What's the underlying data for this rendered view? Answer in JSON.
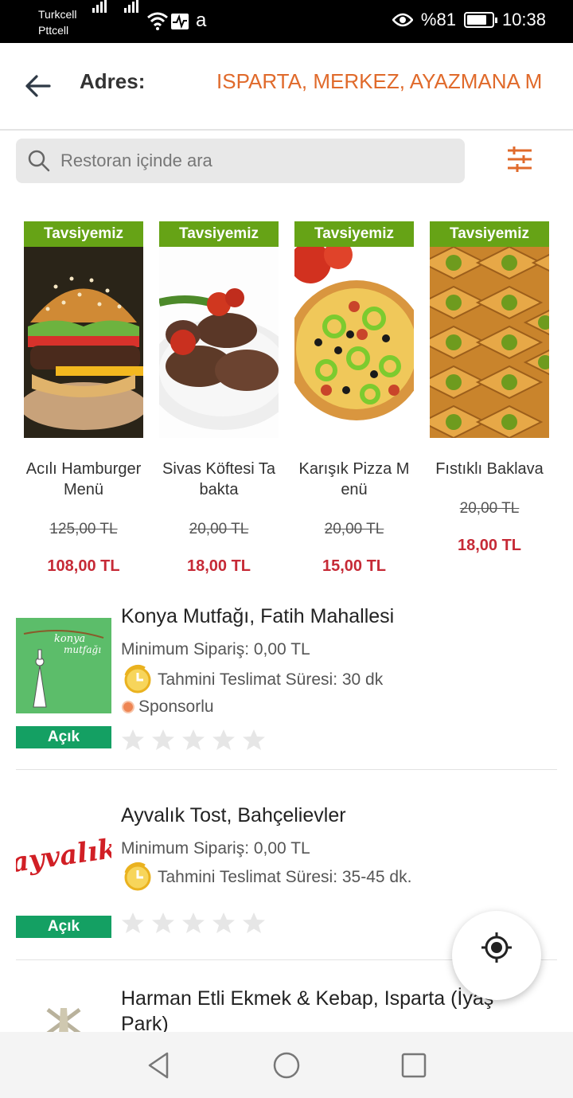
{
  "status_bar": {
    "carrier1": "Turkcell",
    "carrier2": "Pttcell",
    "extra": "a",
    "battery": "%81",
    "battery_level": 0.81,
    "time": "10:38"
  },
  "header": {
    "address_label": "Adres:",
    "address_value": "ISPARTA, MERKEZ, AYAZMANA M"
  },
  "search": {
    "placeholder": "Restoran içinde ara"
  },
  "recommendations": [
    {
      "badge": "Tavsiyemiz",
      "name": "Acılı Hamburger Menü",
      "old_price": "125,00 TL",
      "price": "108,00 TL"
    },
    {
      "badge": "Tavsiyemiz",
      "name": "Sivas Köftesi Tabakta",
      "old_price": "20,00 TL",
      "price": "18,00 TL"
    },
    {
      "badge": "Tavsiyemiz",
      "name": "Karışık Pizza Menü",
      "old_price": "20,00 TL",
      "price": "15,00 TL"
    },
    {
      "badge": "Tavsiyemiz",
      "name": "Fıstıklı Baklava",
      "old_price": "20,00 TL",
      "price": "18,00 TL"
    }
  ],
  "restaurants": [
    {
      "name": "Konya Mutfağı, Fatih Mahallesi",
      "min_order": "Minimum Sipariş: 0,00 TL",
      "eta": "Tahmini Teslimat Süresi: 30 dk",
      "sponsored": "Sponsorlu",
      "status": "Açık",
      "rating": 0,
      "logo_text": "konya mutfağı"
    },
    {
      "name": "Ayvalık Tost, Bahçelievler",
      "min_order": "Minimum Sipariş: 0,00 TL",
      "eta": "Tahmini Teslimat Süresi: 35-45 dk.",
      "status": "Açık",
      "rating": 0,
      "logo_text": "ayvalık"
    },
    {
      "name_line1": "Harman Etli Ekmek & Kebap, Isparta (İyaş",
      "name_line2": "Park)"
    }
  ],
  "colors": {
    "accent": "#e06a2b",
    "badge_green": "#66a316",
    "open_green": "#14a063",
    "price_red": "#c62a36"
  }
}
